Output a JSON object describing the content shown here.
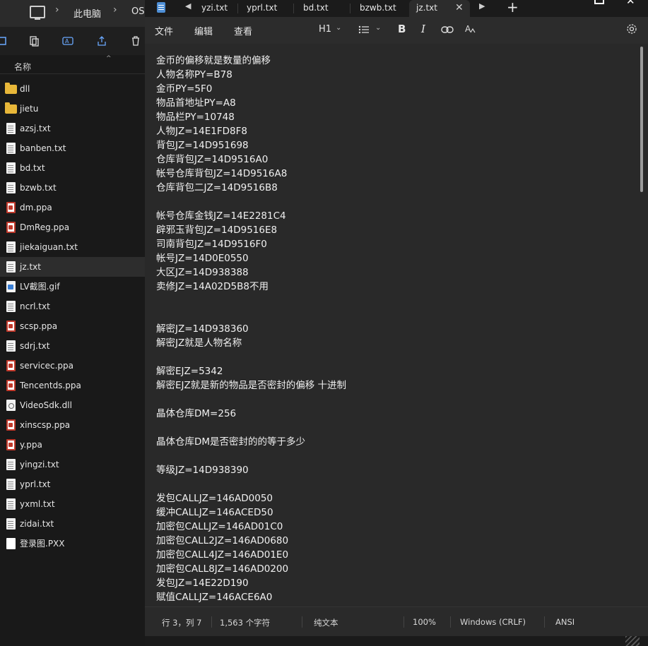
{
  "explorer": {
    "breadcrumb": [
      "此电脑",
      "OS"
    ],
    "column_header": "名称",
    "files": [
      {
        "name": "dll",
        "type": "folder"
      },
      {
        "name": "jietu",
        "type": "folder"
      },
      {
        "name": "azsj.txt",
        "type": "txt"
      },
      {
        "name": "banben.txt",
        "type": "txt"
      },
      {
        "name": "bd.txt",
        "type": "txt"
      },
      {
        "name": "bzwb.txt",
        "type": "txt"
      },
      {
        "name": "dm.ppa",
        "type": "ppa"
      },
      {
        "name": "DmReg.ppa",
        "type": "ppa"
      },
      {
        "name": "jiekaiguan.txt",
        "type": "txt"
      },
      {
        "name": "jz.txt",
        "type": "txt",
        "selected": true
      },
      {
        "name": "LV截图.gif",
        "type": "gif"
      },
      {
        "name": "ncrl.txt",
        "type": "txt"
      },
      {
        "name": "scsp.ppa",
        "type": "ppa"
      },
      {
        "name": "sdrj.txt",
        "type": "txt"
      },
      {
        "name": "servicec.ppa",
        "type": "ppa"
      },
      {
        "name": "Tencentds.ppa",
        "type": "ppa"
      },
      {
        "name": "VideoSdk.dll",
        "type": "dll"
      },
      {
        "name": "xinscsp.ppa",
        "type": "ppa"
      },
      {
        "name": "y.ppa",
        "type": "ppa"
      },
      {
        "name": "yingzi.txt",
        "type": "txt"
      },
      {
        "name": "yprl.txt",
        "type": "txt"
      },
      {
        "name": "yxml.txt",
        "type": "txt"
      },
      {
        "name": "zidai.txt",
        "type": "txt"
      },
      {
        "name": "登录图.PXX",
        "type": "pxx"
      }
    ]
  },
  "notepad": {
    "tabs": [
      {
        "label": "yzi.txt",
        "active": false
      },
      {
        "label": "yprl.txt",
        "active": false
      },
      {
        "label": "bd.txt",
        "active": false
      },
      {
        "label": "bzwb.txt",
        "active": false
      },
      {
        "label": "jz.txt",
        "active": true
      }
    ],
    "menu": {
      "file": "文件",
      "edit": "编辑",
      "view": "查看"
    },
    "format": {
      "heading": "H1"
    },
    "content_lines": [
      "金币的偏移就是数量的偏移",
      "人物名称PY=B78",
      "金币PY=5F0",
      "物品首地址PY=A8",
      "物品栏PY=10748",
      "人物JZ=14E1FD8F8",
      "背包JZ=14D951698",
      "仓库背包JZ=14D9516A0",
      "帐号仓库背包JZ=14D9516A8",
      "仓库背包二JZ=14D9516B8",
      "",
      "帐号仓库金钱JZ=14E2281C4",
      "辟邪玉背包JZ=14D9516E8",
      "司南背包JZ=14D9516F0",
      "帐号JZ=14D0E0550",
      "大区JZ=14D938388",
      "卖修JZ=14A02D5B8不用",
      "",
      "",
      "解密JZ=14D938360",
      "解密JZ就是人物名称",
      "",
      "解密EJZ=5342",
      "解密EJZ就是新的物品是否密封的偏移 十进制",
      "",
      "晶体仓库DM=256",
      "",
      "晶体仓库DM是否密封的的等于多少",
      "",
      "等级JZ=14D938390",
      "",
      "发包CALLJZ=146AD0050",
      "缓冲CALLJZ=146ACED50",
      "加密包CALLJZ=146AD01C0",
      "加密包CALL2JZ=146AD0680",
      "加密包CALL4JZ=146AD01E0",
      "加密包CALL8JZ=146AD0200",
      "发包JZ=14E22D190",
      "赋值CALLJZ=146ACE6A0"
    ],
    "status": {
      "position": "行 3，列 7",
      "chars": "1,563 个字符",
      "format": "纯文本",
      "zoom": "100%",
      "line_ending": "Windows (CRLF)",
      "encoding": "ANSI"
    }
  }
}
